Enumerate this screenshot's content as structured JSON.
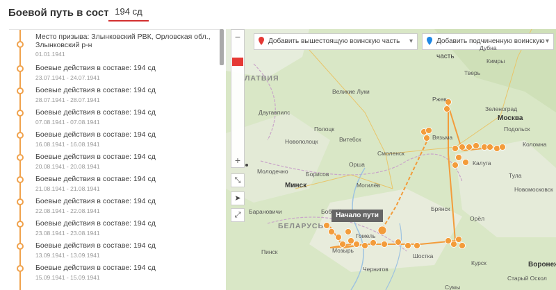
{
  "header": {
    "title": "Боевой путь в составе:",
    "unit": "194 сд"
  },
  "timeline": [
    {
      "text": "Место призыва: Злынковский РВК, Орловская обл., Злынковский р-н",
      "date": "01.01.1941"
    },
    {
      "text": "Боевые действия в составе: 194 сд",
      "date": "23.07.1941 - 24.07.1941"
    },
    {
      "text": "Боевые действия в составе: 194 сд",
      "date": "28.07.1941 - 28.07.1941"
    },
    {
      "text": "Боевые действия в составе: 194 сд",
      "date": "07.08.1941 - 07.08.1941"
    },
    {
      "text": "Боевые действия в составе: 194 сд",
      "date": "16.08.1941 - 16.08.1941"
    },
    {
      "text": "Боевые действия в составе: 194 сд",
      "date": "20.08.1941 - 20.08.1941"
    },
    {
      "text": "Боевые действия в составе: 194 сд",
      "date": "21.08.1941 - 21.08.1941"
    },
    {
      "text": "Боевые действия в составе: 194 сд",
      "date": "22.08.1941 - 22.08.1941"
    },
    {
      "text": "Боевые действия в составе: 194 сд",
      "date": "23.08.1941 - 23.08.1941"
    },
    {
      "text": "Боевые действия в составе: 194 сд",
      "date": "13.09.1941 - 13.09.1941"
    },
    {
      "text": "Боевые действия в составе: 194 сд",
      "date": "15.09.1941 - 15.09.1941"
    }
  ],
  "map": {
    "dropdown_parent": "Добавить вышестоящую воинскую часть",
    "dropdown_child": "Добавить подчиненную воинскую часть",
    "start_label": "Начало пути",
    "zoom_minus": "−",
    "zoom_plus": "+",
    "labels": [
      "ЛАТВИЯ",
      "БЕЛАРУСЬ",
      "Тверь",
      "Великие Луки",
      "Ржев",
      "Зеленоград",
      "Москва",
      "Подольск",
      "Вязьма",
      "Витебск",
      "Смоленск",
      "Калуга",
      "Тула",
      "Полоцк",
      "Даугавпилс",
      "Новополоцк",
      "Минск",
      "Молодечно",
      "Борисов",
      "Орша",
      "Могилёв",
      "Брянск",
      "Орёл",
      "Бобруйск",
      "Барановичи",
      "Гомель",
      "Мозырь",
      "Шостка",
      "Чернигов",
      "Курск",
      "Воронеж",
      "Старый Оскол",
      "Сумы",
      "Коломна",
      "Пинск",
      "Новомосковск",
      "Дубна",
      "Кимры"
    ]
  },
  "colors": {
    "accent": "#d32f2f",
    "route": "#f39c3b",
    "timeline": "#f0a24c"
  }
}
